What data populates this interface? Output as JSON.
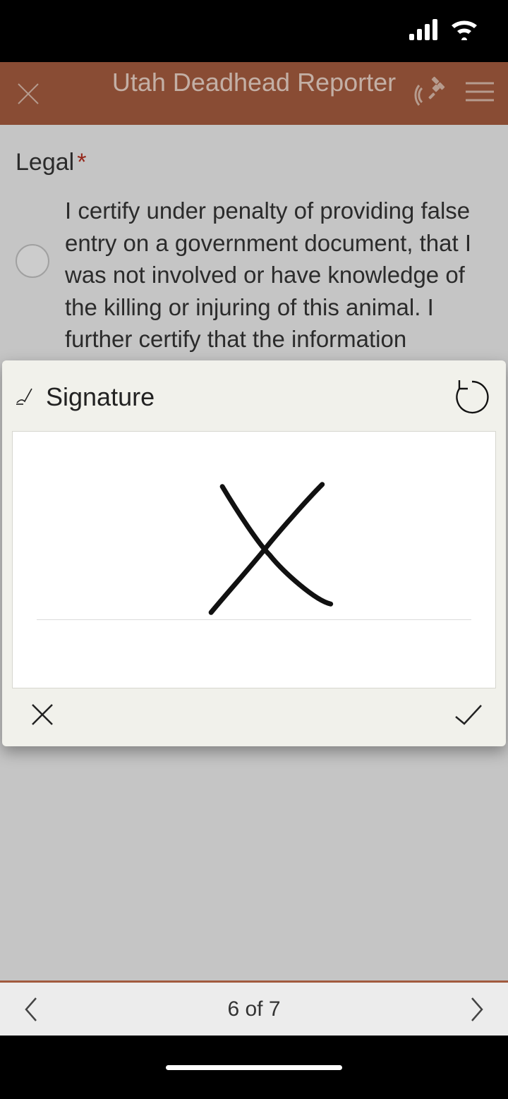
{
  "header": {
    "title": "Utah Deadhead Reporter"
  },
  "form": {
    "section_label": "Legal",
    "required_marker": "*",
    "legal_text": "I certify under penalty of providing false entry on a government document, that I was not involved or have knowledge of the killing or injuring of this animal. I further certify that the information submitted is complete and accurate to the best of my knowledge and belief."
  },
  "signature_modal": {
    "title": "Signature"
  },
  "footer": {
    "page_indicator": "6 of 7"
  },
  "colors": {
    "header_bg": "#a15a3e",
    "header_text": "#e5cec2",
    "accent": "#a15a3e"
  }
}
